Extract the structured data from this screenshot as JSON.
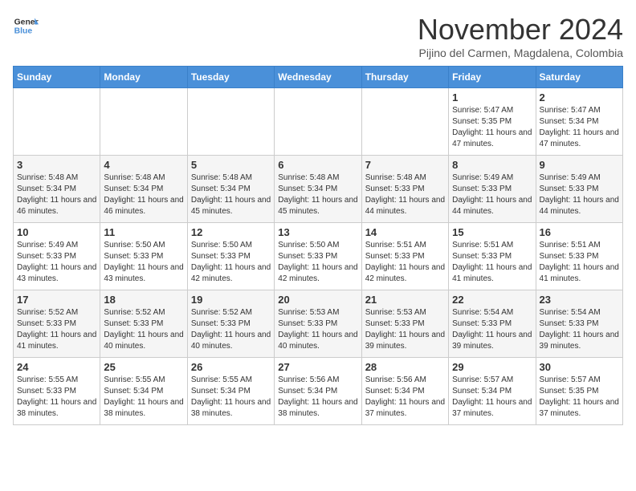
{
  "logo": {
    "line1": "General",
    "line2": "Blue"
  },
  "title": "November 2024",
  "subtitle": "Pijino del Carmen, Magdalena, Colombia",
  "days_of_week": [
    "Sunday",
    "Monday",
    "Tuesday",
    "Wednesday",
    "Thursday",
    "Friday",
    "Saturday"
  ],
  "weeks": [
    [
      {
        "day": "",
        "info": ""
      },
      {
        "day": "",
        "info": ""
      },
      {
        "day": "",
        "info": ""
      },
      {
        "day": "",
        "info": ""
      },
      {
        "day": "",
        "info": ""
      },
      {
        "day": "1",
        "info": "Sunrise: 5:47 AM\nSunset: 5:35 PM\nDaylight: 11 hours and 47 minutes."
      },
      {
        "day": "2",
        "info": "Sunrise: 5:47 AM\nSunset: 5:34 PM\nDaylight: 11 hours and 47 minutes."
      }
    ],
    [
      {
        "day": "3",
        "info": "Sunrise: 5:48 AM\nSunset: 5:34 PM\nDaylight: 11 hours and 46 minutes."
      },
      {
        "day": "4",
        "info": "Sunrise: 5:48 AM\nSunset: 5:34 PM\nDaylight: 11 hours and 46 minutes."
      },
      {
        "day": "5",
        "info": "Sunrise: 5:48 AM\nSunset: 5:34 PM\nDaylight: 11 hours and 45 minutes."
      },
      {
        "day": "6",
        "info": "Sunrise: 5:48 AM\nSunset: 5:34 PM\nDaylight: 11 hours and 45 minutes."
      },
      {
        "day": "7",
        "info": "Sunrise: 5:48 AM\nSunset: 5:33 PM\nDaylight: 11 hours and 44 minutes."
      },
      {
        "day": "8",
        "info": "Sunrise: 5:49 AM\nSunset: 5:33 PM\nDaylight: 11 hours and 44 minutes."
      },
      {
        "day": "9",
        "info": "Sunrise: 5:49 AM\nSunset: 5:33 PM\nDaylight: 11 hours and 44 minutes."
      }
    ],
    [
      {
        "day": "10",
        "info": "Sunrise: 5:49 AM\nSunset: 5:33 PM\nDaylight: 11 hours and 43 minutes."
      },
      {
        "day": "11",
        "info": "Sunrise: 5:50 AM\nSunset: 5:33 PM\nDaylight: 11 hours and 43 minutes."
      },
      {
        "day": "12",
        "info": "Sunrise: 5:50 AM\nSunset: 5:33 PM\nDaylight: 11 hours and 42 minutes."
      },
      {
        "day": "13",
        "info": "Sunrise: 5:50 AM\nSunset: 5:33 PM\nDaylight: 11 hours and 42 minutes."
      },
      {
        "day": "14",
        "info": "Sunrise: 5:51 AM\nSunset: 5:33 PM\nDaylight: 11 hours and 42 minutes."
      },
      {
        "day": "15",
        "info": "Sunrise: 5:51 AM\nSunset: 5:33 PM\nDaylight: 11 hours and 41 minutes."
      },
      {
        "day": "16",
        "info": "Sunrise: 5:51 AM\nSunset: 5:33 PM\nDaylight: 11 hours and 41 minutes."
      }
    ],
    [
      {
        "day": "17",
        "info": "Sunrise: 5:52 AM\nSunset: 5:33 PM\nDaylight: 11 hours and 41 minutes."
      },
      {
        "day": "18",
        "info": "Sunrise: 5:52 AM\nSunset: 5:33 PM\nDaylight: 11 hours and 40 minutes."
      },
      {
        "day": "19",
        "info": "Sunrise: 5:52 AM\nSunset: 5:33 PM\nDaylight: 11 hours and 40 minutes."
      },
      {
        "day": "20",
        "info": "Sunrise: 5:53 AM\nSunset: 5:33 PM\nDaylight: 11 hours and 40 minutes."
      },
      {
        "day": "21",
        "info": "Sunrise: 5:53 AM\nSunset: 5:33 PM\nDaylight: 11 hours and 39 minutes."
      },
      {
        "day": "22",
        "info": "Sunrise: 5:54 AM\nSunset: 5:33 PM\nDaylight: 11 hours and 39 minutes."
      },
      {
        "day": "23",
        "info": "Sunrise: 5:54 AM\nSunset: 5:33 PM\nDaylight: 11 hours and 39 minutes."
      }
    ],
    [
      {
        "day": "24",
        "info": "Sunrise: 5:55 AM\nSunset: 5:33 PM\nDaylight: 11 hours and 38 minutes."
      },
      {
        "day": "25",
        "info": "Sunrise: 5:55 AM\nSunset: 5:34 PM\nDaylight: 11 hours and 38 minutes."
      },
      {
        "day": "26",
        "info": "Sunrise: 5:55 AM\nSunset: 5:34 PM\nDaylight: 11 hours and 38 minutes."
      },
      {
        "day": "27",
        "info": "Sunrise: 5:56 AM\nSunset: 5:34 PM\nDaylight: 11 hours and 38 minutes."
      },
      {
        "day": "28",
        "info": "Sunrise: 5:56 AM\nSunset: 5:34 PM\nDaylight: 11 hours and 37 minutes."
      },
      {
        "day": "29",
        "info": "Sunrise: 5:57 AM\nSunset: 5:34 PM\nDaylight: 11 hours and 37 minutes."
      },
      {
        "day": "30",
        "info": "Sunrise: 5:57 AM\nSunset: 5:35 PM\nDaylight: 11 hours and 37 minutes."
      }
    ]
  ]
}
